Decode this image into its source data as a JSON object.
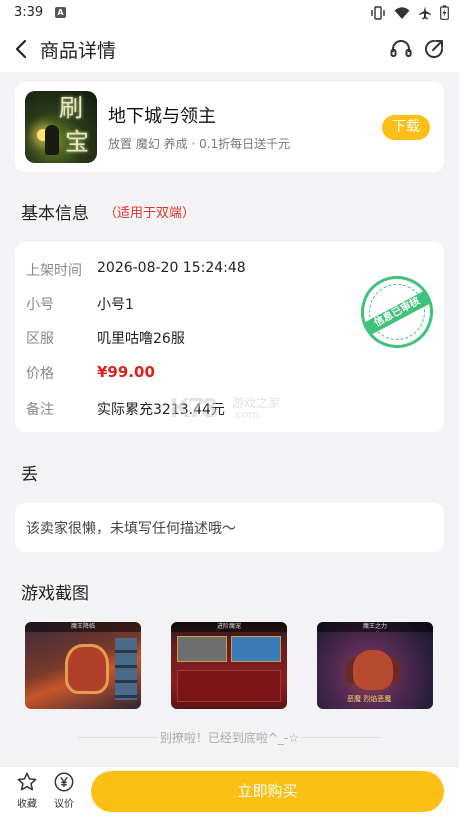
{
  "status_bar": {
    "time": "3:39",
    "notif_badge": "A"
  },
  "app_bar": {
    "title": "商品详情"
  },
  "game": {
    "name": "地下城与领主",
    "tags": "放置 魔幻 养成 · 0.1折每日送千元",
    "download_label": "下载",
    "icon_text_1": "刷",
    "icon_text_2": "宝"
  },
  "basic_info": {
    "title": "基本信息",
    "subtitle": "（适用于双端）",
    "rows": [
      {
        "label": "上架时间",
        "value": "2026-08-20 15:24:48"
      },
      {
        "label": "小号",
        "value": "小号1"
      },
      {
        "label": "区服",
        "value": "叽里咕噜26服"
      },
      {
        "label": "价格",
        "value": "¥99.00"
      },
      {
        "label": "备注",
        "value": "实际累充3213.44元"
      }
    ],
    "stamp_text": "信息已审核"
  },
  "watermark": {
    "logo": "K73",
    "cn": "游戏之家",
    "domain": ".com"
  },
  "seller": {
    "title": "丢",
    "description": "该卖家很懒，未填写任何描述哦～"
  },
  "screenshots": {
    "title": "游戏截图",
    "items": [
      {
        "caption": "魔王降临"
      },
      {
        "caption": "进阶魔宠"
      },
      {
        "caption": "魔王之力",
        "label": "恶魔 烈焰恶魔"
      }
    ]
  },
  "footer_hint": "别撩啦！已经到底啦^_-☆",
  "bottom_bar": {
    "favorite_label": "收藏",
    "bargain_label": "议价",
    "buy_label": "立即购买"
  },
  "colors": {
    "accent": "#fbbf15",
    "price": "#e0201c",
    "stamp": "#3fc27a"
  }
}
